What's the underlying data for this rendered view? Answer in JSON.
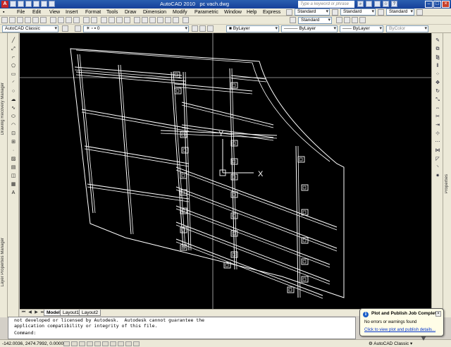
{
  "window": {
    "title": "AutoCAD 2010",
    "filename": "pc vach.dwg",
    "search_placeholder": "Type a keyword or phrase"
  },
  "menu": [
    "File",
    "Edit",
    "View",
    "Insert",
    "Format",
    "Tools",
    "Draw",
    "Dimension",
    "Modify",
    "Parametric",
    "Window",
    "Help",
    "Express"
  ],
  "styles": {
    "text_style": "Standard",
    "dim_style": "Standard",
    "table_style": "Standard",
    "mleader_style": "Standard"
  },
  "workspace_combo": "AutoCAD Classic",
  "layers": {
    "current_layer": "0",
    "color": "ByLayer",
    "linetype": "ByLayer",
    "lineweight": "ByLayer",
    "plotstyle": "ByColor"
  },
  "palettes": {
    "left_top": "Drawing Recovery Manager",
    "left_bottom": "Layer Properties Manager",
    "right": "Properties"
  },
  "tabs": [
    "Model",
    "Layout1",
    "Layout2"
  ],
  "active_tab": "Model",
  "command_window": {
    "line1": "not developed or licensed by Autodesk.  Autodesk cannot guarantee the",
    "line2": "application compatibility or integrity of this file.",
    "prompt": "Command:"
  },
  "status": {
    "coordinates": "-142.0036, 2474.7992, 0.0000",
    "workspace": "AutoCAD Classic"
  },
  "notification": {
    "title": "Plot and Publish Job Complete",
    "message": "No errors or warnings found",
    "link": "Click to view plot and publish details..."
  },
  "ucs": {
    "x_label": "X",
    "y_label": "Y"
  },
  "colors": {
    "viewport_bg": "#000000",
    "geometry": "#ffffff",
    "title_bar": "#16409a"
  }
}
